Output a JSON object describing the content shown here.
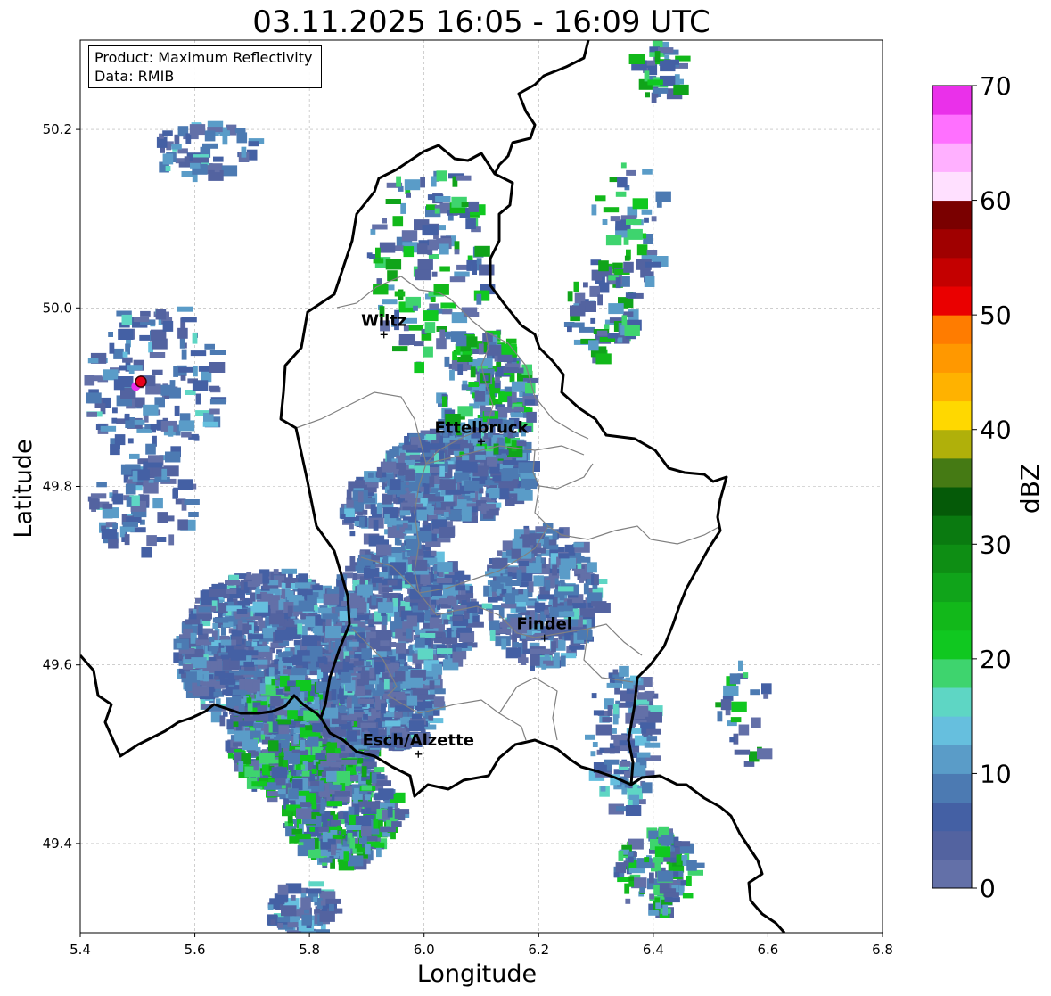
{
  "title": "03.11.2025 16:05 - 16:09 UTC",
  "info_box": {
    "product_line": "Product: Maximum Reflectivity",
    "data_line": "Data: RMIB"
  },
  "axes": {
    "xlabel": "Longitude",
    "ylabel": "Latitude",
    "xlim": [
      5.4,
      6.8
    ],
    "ylim": [
      49.3,
      50.3
    ],
    "xticks": [
      "5.4",
      "5.6",
      "5.8",
      "6.0",
      "6.2",
      "6.4",
      "6.6",
      "6.8"
    ],
    "yticks": [
      "49.4",
      "49.6",
      "49.8",
      "50.0",
      "50.2"
    ],
    "grid": true
  },
  "cities": [
    {
      "name": "Wiltz",
      "lon": 5.93,
      "lat": 49.97
    },
    {
      "name": "Ettelbruck",
      "lon": 6.1,
      "lat": 49.85
    },
    {
      "name": "Findel",
      "lon": 6.21,
      "lat": 49.63
    },
    {
      "name": "Esch/Alzette",
      "lon": 5.99,
      "lat": 49.5
    }
  ],
  "radar_site": {
    "lon": 5.505,
    "lat": 49.915
  },
  "colorbar": {
    "label": "dBZ",
    "ticks": [
      "0",
      "10",
      "20",
      "30",
      "40",
      "50",
      "60",
      "70"
    ],
    "min": 0,
    "max": 70,
    "colors": [
      "#6370a8",
      "#5363a0",
      "#4460a4",
      "#4c7ab2",
      "#5a9cc8",
      "#66bfde",
      "#5ed6c4",
      "#3ed46e",
      "#10c820",
      "#12b81a",
      "#10a41a",
      "#0e8e14",
      "#0a7a10",
      "#055a08",
      "#457a14",
      "#b0b00a",
      "#ffd800",
      "#ffb200",
      "#ff9800",
      "#ff7c00",
      "#ea0000",
      "#c40000",
      "#a00000",
      "#7a0000",
      "#ffe0ff",
      "#ffb0ff",
      "#ff70ff",
      "#ea30ea"
    ]
  },
  "colors": {
    "border": "#000000",
    "canton_lines": "#808080",
    "grid": "#b0b0b0",
    "radar_marker": "#e8001a"
  }
}
